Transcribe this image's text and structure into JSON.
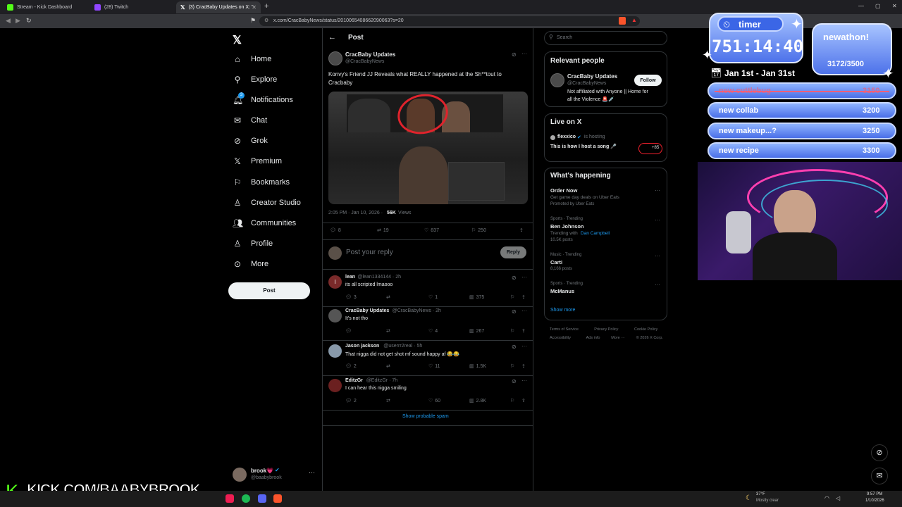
{
  "browser": {
    "tabs": [
      {
        "label": "Stream - Kick Dashboard",
        "color": "#53fc18"
      },
      {
        "label": "(28) Twitch",
        "color": "#9146ff"
      },
      {
        "label": "(3) CracBaby Updates on X: \"",
        "color": "#ffffff"
      }
    ],
    "url": "x.com/CracBabyNews/status/2010065408662090063?s=20"
  },
  "nav": {
    "items": [
      "Home",
      "Explore",
      "Notifications",
      "Chat",
      "Grok",
      "Premium",
      "Bookmarks",
      "Creator Studio",
      "Communities",
      "Profile",
      "More"
    ],
    "notif_badge": "3",
    "post_label": "Post",
    "user_name": "brook💗",
    "user_handle": "@baabybrook"
  },
  "post": {
    "header": "Post",
    "author": "CracBaby Updates",
    "handle": "@CracBabyNews",
    "text_line1": "Konvy's Friend JJ Reveals what REALLY happened at the Sh**tout to",
    "text_line2": "Cracbaby",
    "timestamp": "2:05 PM · Jan 10, 2026 ·",
    "views_count": "56K",
    "views_label": "Views",
    "replies": "8",
    "reposts": "19",
    "likes": "837",
    "bookmarks": "250",
    "reply_placeholder": "Post your reply",
    "reply_button": "Reply"
  },
  "replies": [
    {
      "name": "lean",
      "meta": "@lean1334144 · 2h",
      "text": "its all scripted lmaooo",
      "r": "3",
      "rt": "",
      "l": "1",
      "v": "375",
      "color": "#7a2a2a",
      "initial": "l"
    },
    {
      "name": "CracBaby Updates",
      "meta": "@CracBabyNews · 2h",
      "text": "It's not tho",
      "r": "",
      "rt": "",
      "l": "4",
      "v": "267",
      "color": "#555",
      "initial": ""
    },
    {
      "name": "Jason jackson",
      "meta": "@userrr2real · 5h",
      "text": "That nigga did not get shot mf sound happy af 😂😂",
      "r": "2",
      "rt": "",
      "l": "11",
      "v": "1.5K",
      "color": "#8899aa",
      "initial": ""
    },
    {
      "name": "EditzGr",
      "meta": "@EditzGr · 7h",
      "text": "I can hear this nigga smiling",
      "r": "2",
      "rt": "",
      "l": "60",
      "v": "2.8K",
      "color": "#6b2020",
      "initial": ""
    }
  ],
  "show_spam": "Show probable spam",
  "right": {
    "search_placeholder": "Search",
    "relevant_title": "Relevant people",
    "rel_name": "CracBaby Updates",
    "rel_handle": "@CracBabyNews",
    "rel_bio_1": "Not affiliated with Anyone || Home for",
    "rel_bio_2": "all the Violence 🚨💉",
    "follow_label": "Follow",
    "live_title": "Live on X",
    "live_host": "flexxico",
    "live_status": "is hosting",
    "live_text": "This is how I host a song 🎤",
    "live_count": "+85",
    "happening_title": "What's happening",
    "trends": [
      {
        "cat": "",
        "title": "Order Now",
        "sub1": "Get game day deals on Uber Eats",
        "sub2": "Promoted by Uber Eats"
      },
      {
        "cat": "Sports · Trending",
        "title": "Ben Johnson",
        "sub1": "Trending with",
        "sub1b": "Dan Campbell",
        "sub2": "10.5K posts"
      },
      {
        "cat": "Music · Trending",
        "title": "Carti",
        "sub1": "",
        "sub2": "8,166 posts"
      },
      {
        "cat": "Sports · Trending",
        "title": "McManus",
        "sub1": "",
        "sub2": ""
      }
    ],
    "show_more": "Show more",
    "footer1": [
      "Terms of Service",
      "Privacy Policy",
      "Cookie Policy"
    ],
    "footer2": [
      "Accessibility",
      "Ads info",
      "More ···",
      "© 2026 X Corp."
    ]
  },
  "overlay": {
    "timer_label": "timer",
    "timer_value": "751:14:40",
    "subathon_label": "newathon!",
    "subathon_count": "3172/3500",
    "date_range": "Jan 1st - Jan 31st",
    "goals": [
      {
        "label": "new cuttlebug",
        "value": "3150",
        "done": true
      },
      {
        "label": "new collab",
        "value": "3200",
        "done": false
      },
      {
        "label": "new makeup...?",
        "value": "3250",
        "done": false
      },
      {
        "label": "new recipe",
        "value": "3300",
        "done": false
      }
    ],
    "kick_url": "KICK.COM/BAABYBROOK"
  },
  "taskbar": {
    "weather_temp": "37°F",
    "weather_desc": "Mostly clear",
    "time": "9:57 PM",
    "date": "1/10/2026"
  }
}
